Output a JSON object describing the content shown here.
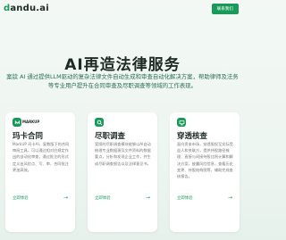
{
  "header": {
    "logo_prefix": "d",
    "logo_rest": "andu.ai",
    "contact_label": "联系我们"
  },
  "hero": {
    "title": "AI再造法律服务",
    "description": "案牍 AI 通过提供LLM驱动的复杂法律文件自动生成和审查自动化解决方案，帮助律师及法务等专业用户提升在合同审查及尽职调查等领域的工作表现。"
  },
  "cards": [
    {
      "icon": "markup-logo-icon",
      "brand": "MARKUP",
      "title": "玛卡合同",
      "description": "MarkUP 玛卡AI，复数版下的合同审阅工具，可以通过相对应规定作出的自动化审查，通过批注的形式定义出风险点、写、审，合同批注更加高效。",
      "link_label": "立即体验"
    },
    {
      "icon": "search-icon",
      "brand": "",
      "title": "尽职调查",
      "description": "案牍的尽职调查模块能够以AI自动梳理专业数据源及文件资料的数据要点，分析和发现企业工作，并生成尽职调查报告以及法律意见书。",
      "link_label": "立即体验"
    },
    {
      "icon": "monitor-icon",
      "brand": "",
      "title": "穿透核查",
      "description": "面向资本市场，穿透股权至实际受益人和关联方，提供持股路径梳理、直接与间接持股比例计算和解决方案，披露风险信息，查看历史变更、持股结构图等，辅助完成查核报告。",
      "link_label": "立即体验"
    }
  ]
}
